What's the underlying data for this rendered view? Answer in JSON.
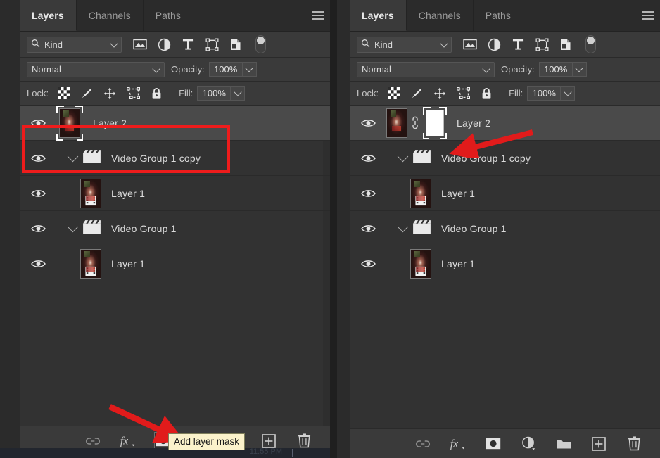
{
  "app": {
    "name": "Adobe Photoshop Layers Panel"
  },
  "panels": {
    "left": {
      "tabs": [
        {
          "label": "Layers",
          "active": true
        },
        {
          "label": "Channels",
          "active": false
        },
        {
          "label": "Paths",
          "active": false
        }
      ],
      "menu_icon": "hamburger-menu-icon",
      "filter": {
        "kind_label": "Kind",
        "search_icon": "search-icon",
        "icons": [
          "pixel-layer-filter-icon",
          "adjustment-layer-filter-icon",
          "type-layer-filter-icon",
          "shape-layer-filter-icon",
          "smart-object-filter-icon"
        ],
        "toggle": "filter-enable-toggle"
      },
      "blend": {
        "mode": "Normal",
        "opacity_label": "Opacity:",
        "opacity_value": "100%"
      },
      "lock": {
        "label": "Lock:",
        "icons": [
          "lock-transparent-pixels-icon",
          "lock-image-pixels-icon",
          "lock-position-icon",
          "lock-artboard-nesting-icon",
          "lock-all-icon"
        ],
        "fill_label": "Fill:",
        "fill_value": "100%"
      },
      "layers": [
        {
          "name": "Layer 2",
          "type": "image",
          "selected": true,
          "indent": 0,
          "has_mask": false,
          "expandable": false,
          "visible": true
        },
        {
          "name": "Video Group 1 copy",
          "type": "group",
          "selected": false,
          "indent": 0,
          "has_mask": false,
          "expandable": true,
          "visible": true
        },
        {
          "name": "Layer 1",
          "type": "video",
          "selected": false,
          "indent": 1,
          "has_mask": false,
          "expandable": false,
          "visible": true
        },
        {
          "name": "Video Group 1",
          "type": "group",
          "selected": false,
          "indent": 0,
          "has_mask": false,
          "expandable": true,
          "visible": true
        },
        {
          "name": "Layer 1",
          "type": "video",
          "selected": false,
          "indent": 1,
          "has_mask": false,
          "expandable": false,
          "visible": true
        }
      ],
      "bottom_icons": [
        "link-layers-icon",
        "add-layer-style-fx-icon",
        "add-layer-mask-icon",
        "new-fill-adjustment-layer-icon",
        "new-group-icon",
        "new-layer-icon",
        "delete-layer-icon"
      ],
      "tooltip": "Add layer mask",
      "taskbar_clock": "11:55 PM"
    },
    "right": {
      "tabs": [
        {
          "label": "Layers",
          "active": true
        },
        {
          "label": "Channels",
          "active": false
        },
        {
          "label": "Paths",
          "active": false
        }
      ],
      "menu_icon": "hamburger-menu-icon",
      "filter": {
        "kind_label": "Kind",
        "search_icon": "search-icon",
        "icons": [
          "pixel-layer-filter-icon",
          "adjustment-layer-filter-icon",
          "type-layer-filter-icon",
          "shape-layer-filter-icon",
          "smart-object-filter-icon"
        ],
        "toggle": "filter-enable-toggle"
      },
      "blend": {
        "mode": "Normal",
        "opacity_label": "Opacity:",
        "opacity_value": "100%"
      },
      "lock": {
        "label": "Lock:",
        "icons": [
          "lock-transparent-pixels-icon",
          "lock-image-pixels-icon",
          "lock-position-icon",
          "lock-artboard-nesting-icon",
          "lock-all-icon"
        ],
        "fill_label": "Fill:",
        "fill_value": "100%"
      },
      "layers": [
        {
          "name": "Layer 2",
          "type": "image",
          "selected": true,
          "indent": 0,
          "has_mask": true,
          "expandable": false,
          "visible": true
        },
        {
          "name": "Video Group 1 copy",
          "type": "group",
          "selected": false,
          "indent": 0,
          "has_mask": false,
          "expandable": true,
          "visible": true
        },
        {
          "name": "Layer 1",
          "type": "video",
          "selected": false,
          "indent": 1,
          "has_mask": false,
          "expandable": false,
          "visible": true
        },
        {
          "name": "Video Group 1",
          "type": "group",
          "selected": false,
          "indent": 0,
          "has_mask": false,
          "expandable": true,
          "visible": true
        },
        {
          "name": "Layer 1",
          "type": "video",
          "selected": false,
          "indent": 1,
          "has_mask": false,
          "expandable": false,
          "visible": true
        }
      ],
      "bottom_icons": [
        "link-layers-icon",
        "add-layer-style-fx-icon",
        "add-layer-mask-icon",
        "new-fill-adjustment-layer-icon",
        "new-group-icon",
        "new-layer-icon",
        "delete-layer-icon"
      ]
    }
  },
  "annotations": {
    "highlight_color": "#ee1c1c",
    "arrow_color": "#e11b1b",
    "tooltip_bg": "#fbf2cb"
  }
}
